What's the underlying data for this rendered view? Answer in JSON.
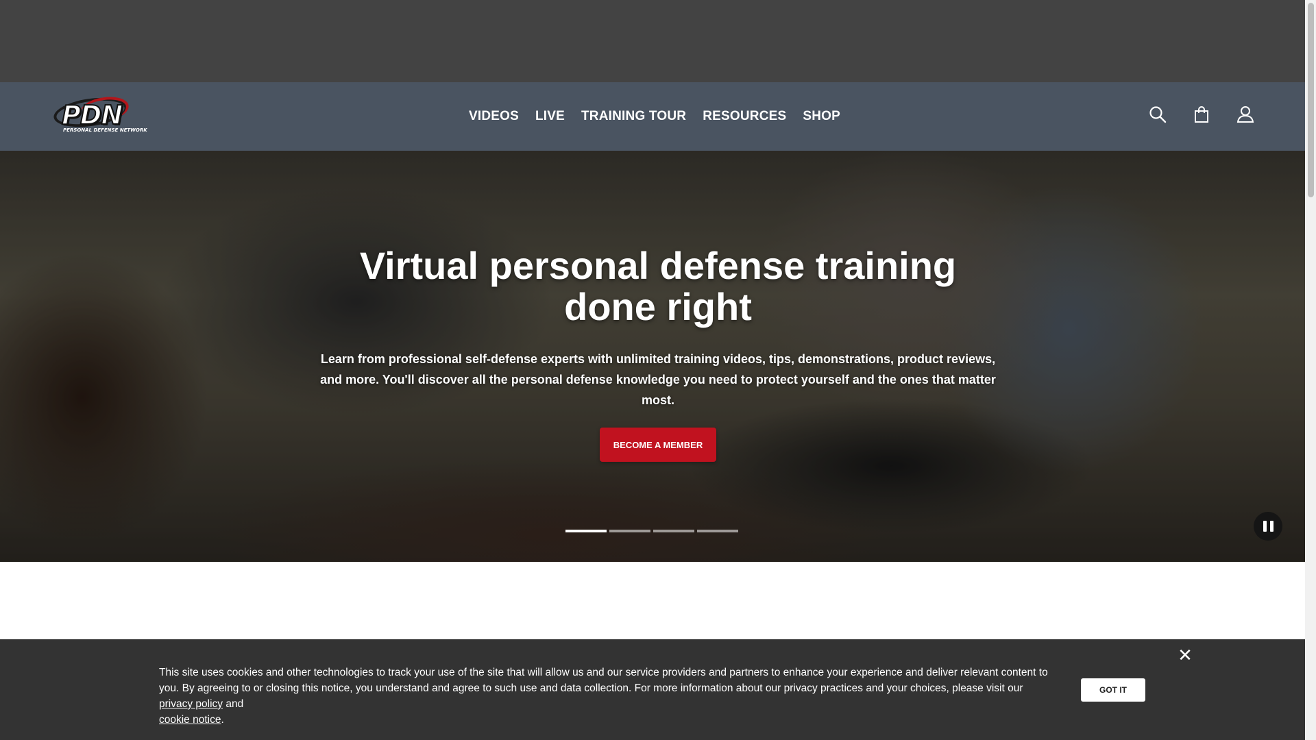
{
  "logo": {
    "mark": "PDN",
    "subtitle": "PERSONAL DEFENSE NETWORK"
  },
  "nav": {
    "items": [
      {
        "label": "VIDEOS"
      },
      {
        "label": "LIVE"
      },
      {
        "label": "TRAINING TOUR"
      },
      {
        "label": "RESOURCES"
      },
      {
        "label": "SHOP"
      }
    ]
  },
  "header_icons": [
    "search-icon",
    "shopping-bag-icon",
    "user-icon"
  ],
  "hero": {
    "title": "Virtual personal defense training done right",
    "text": "Learn from professional self-defense experts with unlimited training videos, tips, demonstrations, product reviews, and more. You'll discover all the personal defense knowledge you need to protect yourself and the ones that matter most.",
    "cta_label": "BECOME A MEMBER",
    "slide_count": 4,
    "active_slide": 1
  },
  "cookie": {
    "text_before": "This site uses cookies and other technologies to track your use of the site that will allow us and our service providers and partners to enhance your experience and deliver relevant content to you. By agreeing to or closing this notice, you understand and agree to such use and data collection. For more information about our privacy practices and your choices, please visit our ",
    "privacy_link": "privacy policy",
    "text_middle": " and ",
    "cookie_link": "cookie notice",
    "text_after": ".",
    "close_glyph": "✕",
    "button_label": "GOT IT"
  },
  "colors": {
    "ad_bar": "#434343",
    "header": "#4a5461",
    "cta": "#c1121f",
    "cookie_bg": "#333333"
  }
}
